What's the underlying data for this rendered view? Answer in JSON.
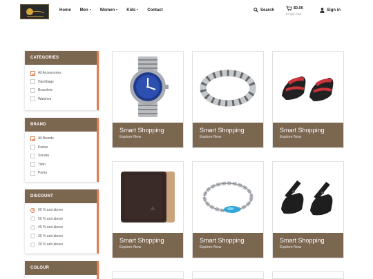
{
  "header": {
    "nav": [
      {
        "label": "Home",
        "dropdown": false
      },
      {
        "label": "Men",
        "dropdown": true
      },
      {
        "label": "Women",
        "dropdown": true
      },
      {
        "label": "Kids",
        "dropdown": true
      },
      {
        "label": "Contact",
        "dropdown": false
      }
    ],
    "search_label": "Search",
    "cart_price": "$0.00",
    "cart_status": "Empty Cart",
    "signin_label": "Sign in"
  },
  "filters": {
    "categories": {
      "title": "CATEGORIES",
      "options": [
        {
          "label": "All Accessories",
          "checked": true
        },
        {
          "label": "Handbags",
          "checked": false
        },
        {
          "label": "Bracelets",
          "checked": false
        },
        {
          "label": "Watches",
          "checked": false
        }
      ]
    },
    "brand": {
      "title": "BRAND",
      "options": [
        {
          "label": "All Brands",
          "checked": true
        },
        {
          "label": "Kurtas",
          "checked": false
        },
        {
          "label": "Sonata",
          "checked": false
        },
        {
          "label": "Titan",
          "checked": false
        },
        {
          "label": "Puma",
          "checked": false
        }
      ]
    },
    "discount": {
      "title": "DISCOUNT",
      "options": [
        {
          "label": "60 % and above",
          "checked": true
        },
        {
          "label": "50 % and above",
          "checked": false
        },
        {
          "label": "40 % and above",
          "checked": false
        },
        {
          "label": "30 % and above",
          "checked": false
        },
        {
          "label": "20 % and above",
          "checked": false
        }
      ]
    },
    "colour": {
      "title": "COLOUR"
    }
  },
  "products": [
    {
      "title": "Smart Shopping",
      "subtitle": "Explore Now",
      "icon": "watch-icon"
    },
    {
      "title": "Smart Shopping",
      "subtitle": "Explore Now",
      "icon": "metal-bracelet-icon"
    },
    {
      "title": "Smart Shopping",
      "subtitle": "Explore Now",
      "icon": "sandals-icon"
    },
    {
      "title": "Smart Shopping",
      "subtitle": "Explore Now",
      "icon": "wallet-icon"
    },
    {
      "title": "Smart Shopping",
      "subtitle": "Explore Now",
      "icon": "chain-bracelet-icon"
    },
    {
      "title": "Smart Shopping",
      "subtitle": "Explore Now",
      "icon": "black-sandals-icon"
    }
  ],
  "colors": {
    "accent_brown": "#7b6650",
    "accent_orange": "#e07a4f"
  }
}
